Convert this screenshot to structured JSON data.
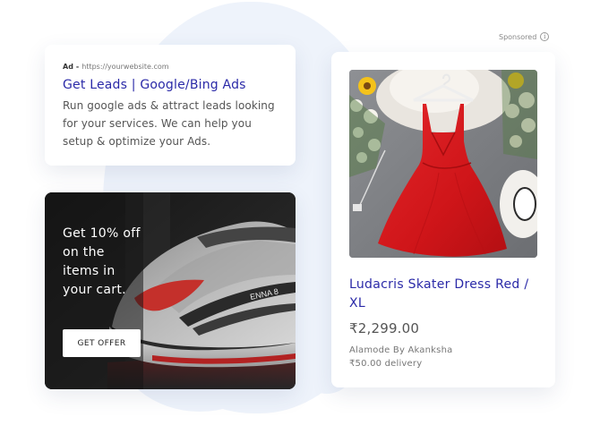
{
  "search_ad": {
    "ad_label": "Ad",
    "separator": "-",
    "url": "https://yourwebsite.com",
    "headline": "Get Leads | Google/Bing Ads",
    "description": "Run google ads & attract leads looking for your services. We can help you setup & optimize your Ads."
  },
  "offer": {
    "text": "Get 10% off on the items in your cart.",
    "button_label": "GET OFFER",
    "shoe_brand_text": "ENNA 8"
  },
  "sponsored": {
    "label": "Sponsored",
    "icon": "info-icon"
  },
  "product": {
    "title": "Ludacris Skater Dress Red / XL",
    "price": "₹2,299.00",
    "seller": "Alamode By Akanksha",
    "delivery": "₹50.00 delivery",
    "image_icon": "red-dress-photo"
  },
  "colors": {
    "accent": "#2b2aa8",
    "background_blob": "#eef3fb",
    "dress_red": "#d8161c"
  }
}
